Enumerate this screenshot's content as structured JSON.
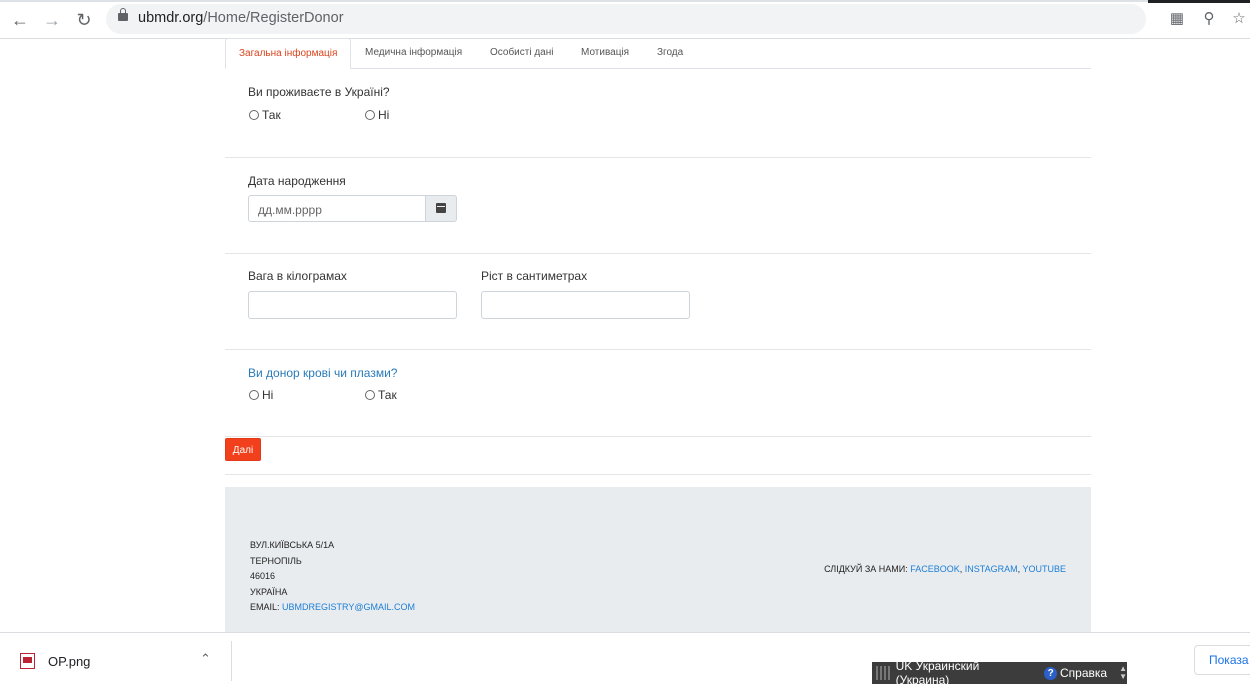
{
  "browser": {
    "url_host": "ubmdr.org",
    "url_path": "/Home/RegisterDonor"
  },
  "tabs": [
    {
      "label": "Загальна інформація",
      "active": true
    },
    {
      "label": "Медична інформація",
      "active": false
    },
    {
      "label": "Особисті дані",
      "active": false
    },
    {
      "label": "Мотивація",
      "active": false
    },
    {
      "label": "Згода",
      "active": false
    }
  ],
  "form": {
    "residence": {
      "question": "Ви проживаєте в Україні?",
      "options": [
        "Так",
        "Ні"
      ]
    },
    "birthdate": {
      "label": "Дата народження",
      "placeholder": "дд.мм.рррр"
    },
    "weight": {
      "label": "Вага в кілограмах",
      "value": ""
    },
    "height": {
      "label": "Ріст в сантиметрах",
      "value": ""
    },
    "donor": {
      "question": "Ви донор крові чи плазми?",
      "options": [
        "Ні",
        "Так"
      ]
    },
    "next_label": "Далі"
  },
  "footer": {
    "address_lines": [
      "ВУЛ.КИЇВСЬКА 5/1А",
      "ТЕРНОПІЛЬ",
      "46016",
      "УКРАЇНА"
    ],
    "email_label": "EMAIL:",
    "email": "UBMDREGISTRY@GMAIL.COM",
    "follow_label": "СЛІДКУЙ ЗА НАМИ:",
    "social": [
      "FACEBOOK",
      "INSTAGRAM",
      "YOUTUBE"
    ]
  },
  "downloads": {
    "file_name": "OP.png",
    "show_all": "Показа"
  },
  "taskbar": {
    "language": "UK Украинский (Украина)",
    "help": "Справка"
  },
  "colors": {
    "accent": "#f2401c",
    "link": "#1c7ed6",
    "active_tab": "#d9441d"
  }
}
